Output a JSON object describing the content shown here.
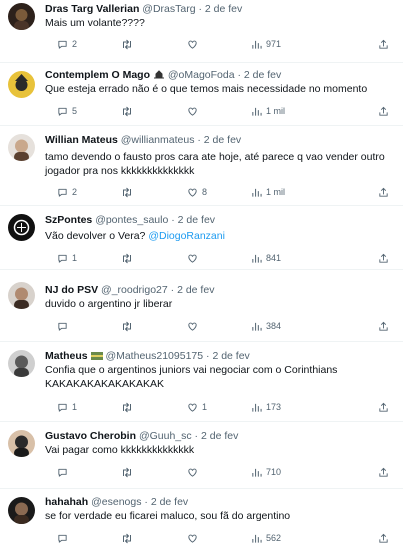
{
  "tweets": [
    {
      "name": "Dras Targ Vallerian",
      "handle": "@DrasTarg",
      "date": "2 de fev",
      "text": "Mais um volante????",
      "replies": "2",
      "retweets": "",
      "likes": "",
      "views": "971",
      "avatar_colors": [
        "#3a2a22",
        "#7a5a3a"
      ]
    },
    {
      "name": "Contemplem O Mago",
      "name_badge": "hat-icon",
      "handle": "@oMagoFoda",
      "date": "2 de fev",
      "text": "Que esteja errado não é o que temos mais necessidade no momento",
      "replies": "5",
      "retweets": "",
      "likes": "",
      "views": "1 mil",
      "avatar_colors": [
        "#e8c23a",
        "#2a2a2a"
      ]
    },
    {
      "name": "Willian Mateus",
      "handle": "@willianmateus",
      "date": "2 de fev",
      "text": "tamo devendo o fausto pros cara ate hoje, até parece q vao vender outro jogador pra nos kkkkkkkkkkkkkk",
      "replies": "2",
      "retweets": "",
      "likes": "8",
      "views": "1 mil",
      "avatar_colors": [
        "#c9a88c",
        "#5a4030"
      ]
    },
    {
      "name": "SzPontes",
      "handle": "@pontes_saulo",
      "date": "2 de fev",
      "text": "Vão devolver o Vera? ",
      "mention": "@DiogoRanzani",
      "replies": "1",
      "retweets": "",
      "likes": "",
      "views": "841",
      "avatar_colors": [
        "#111111",
        "#ffffff"
      ]
    },
    {
      "name": "NJ do PSV",
      "handle": "@_roodrigo27",
      "date": "2 de fev",
      "text": "duvido o argentino jr liberar",
      "replies": "",
      "retweets": "",
      "likes": "",
      "views": "384",
      "avatar_colors": [
        "#b08a70",
        "#3b2b22"
      ]
    },
    {
      "name": "Matheus",
      "name_badge": "flag-emoji",
      "handle": "@Matheus21095175",
      "date": "2 de fev",
      "text": "Confia que o argentinos juniors vai negociar com o Corinthians KAKAKAKAKAKAKAKAK",
      "replies": "1",
      "retweets": "",
      "likes": "1",
      "views": "173",
      "avatar_colors": [
        "#5a5a5a",
        "#cfcfcf"
      ]
    },
    {
      "name": "Gustavo Cherobin",
      "handle": "@Guuh_sc",
      "date": "2 de fev",
      "text": "Vai pagar como kkkkkkkkkkkkkk",
      "replies": "",
      "retweets": "",
      "likes": "",
      "views": "710",
      "avatar_colors": [
        "#2a2a2a",
        "#d8c0a8"
      ]
    },
    {
      "name": "hahahah",
      "handle": "@esenogs",
      "date": "2 de fev",
      "text": "se for verdade eu ficarei maluco, sou fã do argentino",
      "replies": "",
      "retweets": "",
      "likes": "",
      "views": "562",
      "avatar_colors": [
        "#1a1a1a",
        "#8a6a52"
      ]
    }
  ]
}
